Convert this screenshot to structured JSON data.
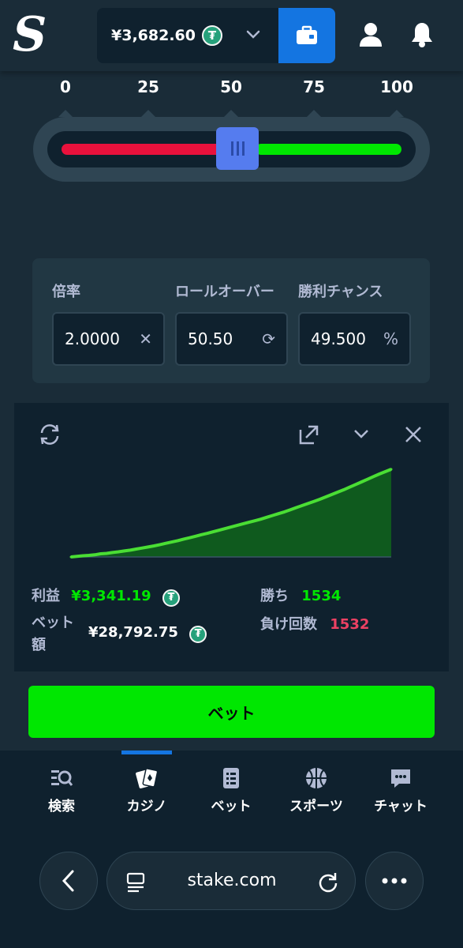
{
  "header": {
    "logo_text": "S",
    "balance": "¥3,682.60",
    "currency_icon": "tether-coin-icon",
    "currency_symbol": "₮"
  },
  "slider": {
    "ticks": [
      "0",
      "25",
      "50",
      "75",
      "100"
    ],
    "value_percent": 50.5,
    "colors": {
      "lose": "#e9113c",
      "win": "#00e701",
      "handle": "#557cef"
    }
  },
  "stats": {
    "multiplier": {
      "label": "倍率",
      "value": "2.0000",
      "suffix": "✕"
    },
    "roll_over": {
      "label": "ロールオーバー",
      "value": "50.50",
      "suffix": "⟳"
    },
    "win_chance": {
      "label": "勝利チャンス",
      "value": "49.500",
      "suffix": "%"
    }
  },
  "live_stats": {
    "profit_label": "利益",
    "profit_value": "¥3,341.19",
    "wagered_label": "ベット額",
    "wagered_value": "¥28,792.75",
    "wins_label": "勝ち",
    "wins_value": "1534",
    "losses_label": "負け回数",
    "losses_value": "1532"
  },
  "chart_data": {
    "type": "area",
    "title": "",
    "xlabel": "",
    "ylabel": "",
    "series": [
      {
        "values": [
          0,
          20,
          45,
          60,
          80,
          120,
          135,
          170,
          195,
          230,
          260,
          300,
          340,
          380,
          420,
          470,
          520,
          570,
          620,
          680,
          730,
          790,
          850,
          900,
          960,
          1020,
          1080,
          1140,
          1200,
          1260,
          1320,
          1380,
          1440,
          1510,
          1580,
          1650,
          1720,
          1800,
          1880,
          1960,
          2040,
          2120,
          2200,
          2290,
          2380,
          2470,
          2560,
          2660,
          2760,
          2860,
          2960,
          3060,
          3160,
          3250,
          3341
        ]
      }
    ],
    "colors": {
      "line": "#4ade34",
      "fill": "#0f5a1e"
    }
  },
  "bet_button": {
    "label": "ベット"
  },
  "bottom_nav": {
    "items": [
      {
        "label": "検索",
        "icon": "search-list-icon"
      },
      {
        "label": "カジノ",
        "icon": "cards-icon"
      },
      {
        "label": "ベット",
        "icon": "bet-slip-icon"
      },
      {
        "label": "スポーツ",
        "icon": "basketball-icon"
      },
      {
        "label": "チャット",
        "icon": "chat-icon"
      }
    ],
    "active_index": 1
  },
  "browser": {
    "url": "stake.com"
  }
}
